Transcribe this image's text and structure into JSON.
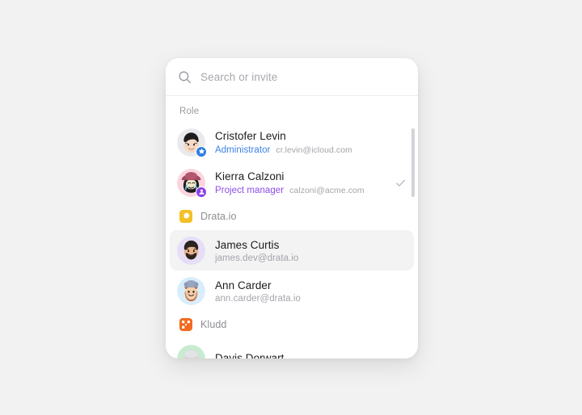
{
  "search": {
    "placeholder": "Search or invite",
    "value": "",
    "icon": "search-icon"
  },
  "section": {
    "label": "Role"
  },
  "colors": {
    "background": "#f2f2f2",
    "card": "#ffffff",
    "selected_row": "#f3f3f4",
    "role_administrator": "#3c7fe8",
    "role_project_manager": "#8c4de8",
    "drata_logo": "#f5c026",
    "kludd_logo": "#f36a21",
    "scrollbar": "#d4d4d8",
    "check": "#b0b0b6"
  },
  "role_people": [
    {
      "name": "Cristofer Levin",
      "role": "Administrator",
      "role_color": "#3c7fe8",
      "email": "cr.levin@icloud.com",
      "badge": "star-badge-icon",
      "selected": false,
      "checked": false
    },
    {
      "name": "Kierra Calzoni",
      "role": "Project manager",
      "role_color": "#8c4de8",
      "email": "calzoni@acme.com",
      "badge": "person-badge-icon",
      "selected": false,
      "checked": true
    }
  ],
  "groups": [
    {
      "name": "Drata.io",
      "logo": "drata-logo-icon",
      "members": [
        {
          "name": "James Curtis",
          "email": "james.dev@drata.io",
          "selected": true,
          "checked": false
        },
        {
          "name": "Ann Carder",
          "email": "ann.carder@drata.io",
          "selected": false,
          "checked": false
        }
      ]
    },
    {
      "name": "Kludd",
      "logo": "kludd-logo-icon",
      "members": [
        {
          "name": "Davis Dorwart",
          "email": "",
          "selected": false,
          "checked": false
        }
      ]
    }
  ]
}
